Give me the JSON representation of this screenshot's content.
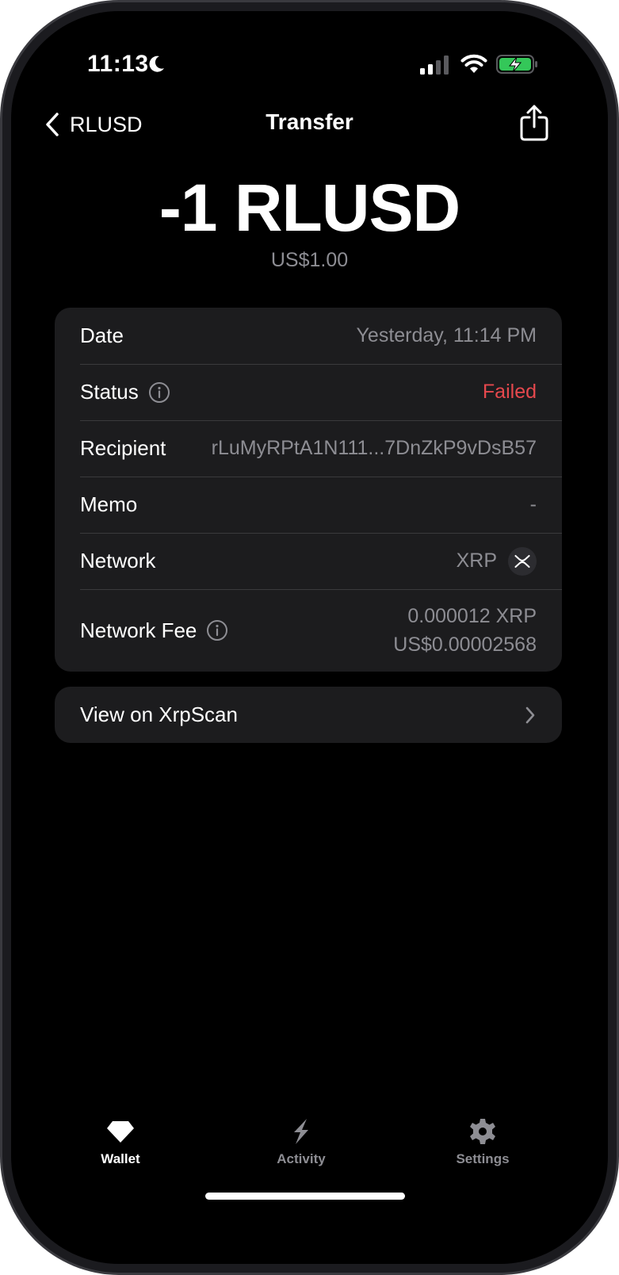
{
  "status_bar": {
    "time": "11:13",
    "moon_icon": "moon-icon",
    "signal_icon": "cellular-signal-icon",
    "wifi_icon": "wifi-icon",
    "battery_icon": "battery-charging-icon",
    "battery_color": "#34c759"
  },
  "nav": {
    "back_label": "RLUSD",
    "title": "Transfer",
    "share_icon": "share-icon"
  },
  "amount": {
    "primary": "-1 RLUSD",
    "fiat": "US$1.00"
  },
  "details": {
    "date": {
      "label": "Date",
      "value": "Yesterday, 11:14 PM"
    },
    "status": {
      "label": "Status",
      "value": "Failed",
      "value_color": "#e5484d"
    },
    "recipient": {
      "label": "Recipient",
      "value": "rLuMyRPtA1N111...7DnZkP9vDsB57"
    },
    "memo": {
      "label": "Memo",
      "value": "-"
    },
    "network": {
      "label": "Network",
      "value": "XRP",
      "icon": "xrp-icon"
    },
    "network_fee": {
      "label": "Network Fee",
      "value_crypto": "0.000012 XRP",
      "value_fiat": "US$0.00002568"
    }
  },
  "explorer_link": {
    "label": "View on XrpScan"
  },
  "tabs": [
    {
      "label": "Wallet",
      "icon": "wallet-gem-icon",
      "active": true
    },
    {
      "label": "Activity",
      "icon": "activity-bolt-icon",
      "active": false
    },
    {
      "label": "Settings",
      "icon": "settings-gear-icon",
      "active": false
    }
  ],
  "colors": {
    "background": "#000000",
    "card": "#1c1c1e",
    "secondary_text": "#8d8d93",
    "failed": "#e5484d"
  }
}
